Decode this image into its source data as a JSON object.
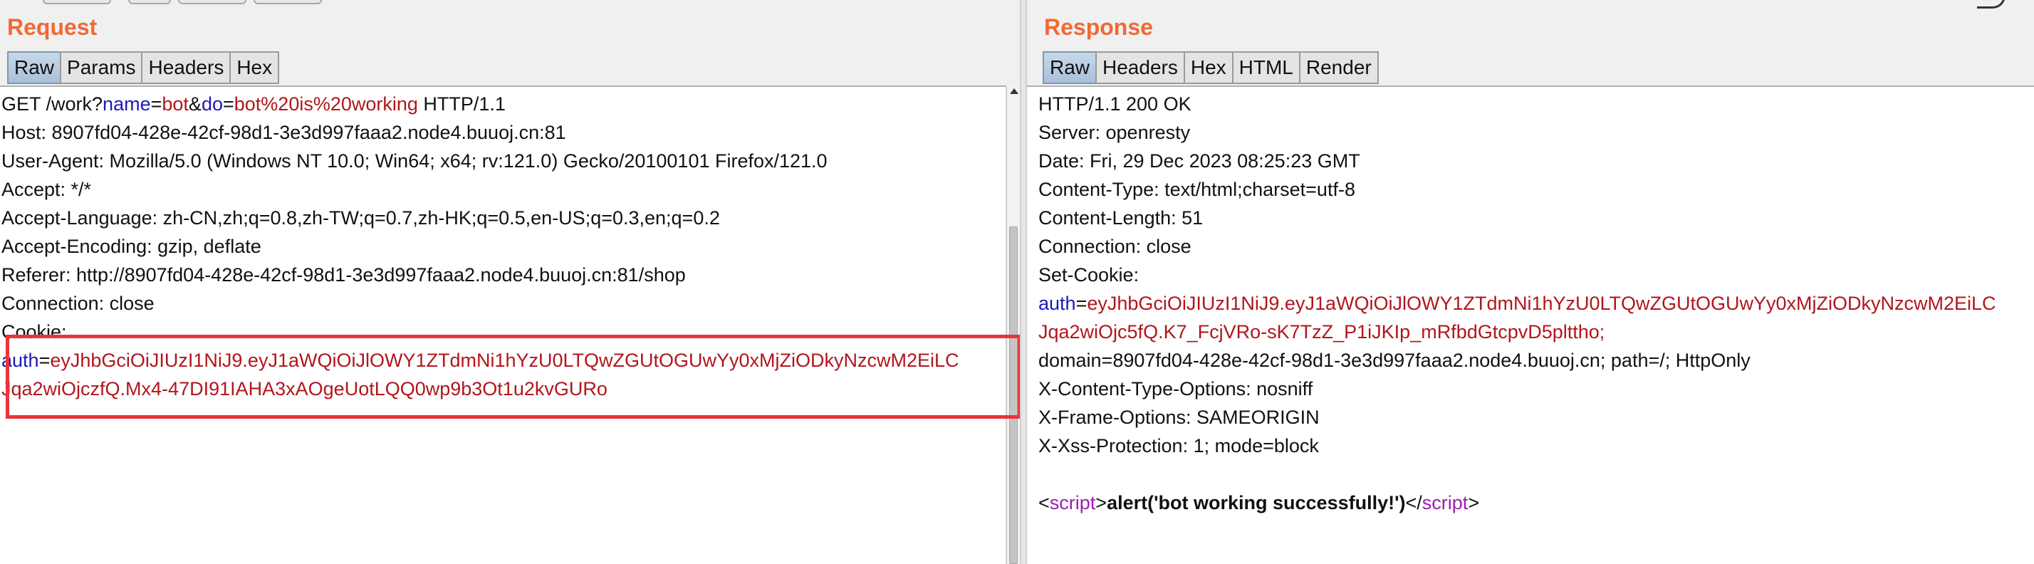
{
  "request": {
    "title": "Request",
    "tabs": [
      {
        "label": "Raw",
        "active": true
      },
      {
        "label": "Params",
        "active": false
      },
      {
        "label": "Headers",
        "active": false
      },
      {
        "label": "Hex",
        "active": false
      }
    ],
    "line1": {
      "a": "GET /work?",
      "k1": "name",
      "e1": "=",
      "v1": "bot",
      "amp": "&",
      "k2": "do",
      "e2": "=",
      "v2": "bot%20is%20working",
      "b": " HTTP/1.1"
    },
    "host": "Host: 8907fd04-428e-42cf-98d1-3e3d997faaa2.node4.buuoj.cn:81",
    "user_agent": "User-Agent: Mozilla/5.0 (Windows NT 10.0; Win64; x64; rv:121.0) Gecko/20100101 Firefox/121.0",
    "accept": "Accept: */*",
    "accept_language": "Accept-Language: zh-CN,zh;q=0.8,zh-TW;q=0.7,zh-HK;q=0.5,en-US;q=0.3,en;q=0.2",
    "accept_encoding": "Accept-Encoding: gzip, deflate",
    "referer": "Referer: http://8907fd04-428e-42cf-98d1-3e3d997faaa2.node4.buuoj.cn:81/shop",
    "connection": "Connection: close",
    "cookie_label": "Cookie:",
    "cookie_key": "auth",
    "cookie_eq": "=",
    "cookie_val1": "eyJhbGciOiJIUzI1NiJ9.eyJ1aWQiOiJlOWY1ZTdmNi1hYzU0LTQwZGUtOGUwYy0xMjZiODkyNzcwM2EiLC",
    "cookie_val2": "Jqa2wiOjczfQ.Mx4-47DI91IAHA3xAOgeUotLQQ0wp9b3Ot1u2kvGURo"
  },
  "response": {
    "title": "Response",
    "tabs": [
      {
        "label": "Raw",
        "active": true
      },
      {
        "label": "Headers",
        "active": false
      },
      {
        "label": "Hex",
        "active": false
      },
      {
        "label": "HTML",
        "active": false
      },
      {
        "label": "Render",
        "active": false
      }
    ],
    "status": "HTTP/1.1 200 OK",
    "server": "Server: openresty",
    "date": "Date: Fri, 29 Dec 2023 08:25:23 GMT",
    "content_type": "Content-Type: text/html;charset=utf-8",
    "content_length": "Content-Length: 51",
    "connection": "Connection: close",
    "set_cookie_label": "Set-Cookie:",
    "sc_key": "auth",
    "sc_eq": "=",
    "sc_val1": "eyJhbGciOiJIUzI1NiJ9.eyJ1aWQiOiJlOWY1ZTdmNi1hYzU0LTQwZGUtOGUwYy0xMjZiODkyNzcwM2EiLC",
    "sc_val2": "Jqa2wiOjc5fQ.K7_FcjVRo-sK7TzZ_P1iJKIp_mRfbdGtcpvD5plttho;",
    "sc_domain": "domain=8907fd04-428e-42cf-98d1-3e3d997faaa2.node4.buuoj.cn; path=/; HttpOnly",
    "x_content_type": "X-Content-Type-Options: nosniff",
    "x_frame": "X-Frame-Options: SAMEORIGIN",
    "x_xss": "X-Xss-Protection: 1; mode=block",
    "body_lt1": "<",
    "body_tag1": "script",
    "body_gt1": ">",
    "body_text": "alert('bot working successfully!')",
    "body_lt2": "</",
    "body_tag2": "script",
    "body_gt2": ">"
  },
  "colors": {
    "title": "#f06a35",
    "param_key": "#1d1ab8",
    "param_value": "#b1161c",
    "html_tag": "#9b1fb0",
    "highlight": "#e8353a"
  }
}
